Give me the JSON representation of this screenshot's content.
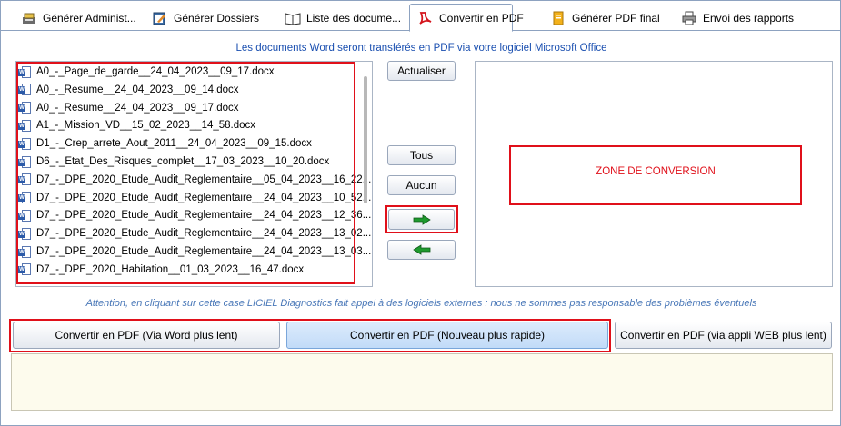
{
  "tabs": [
    {
      "label": "Générer Administ...",
      "icon": "admin-icon"
    },
    {
      "label": "Générer Dossiers",
      "icon": "folder-edit-icon"
    },
    {
      "label": "Liste des docume...",
      "icon": "book-icon"
    },
    {
      "label": "Convertir en PDF",
      "icon": "pdf-icon",
      "active": true
    },
    {
      "label": "Générer PDF final",
      "icon": "pdf-final-icon"
    },
    {
      "label": "Envoi des rapports",
      "icon": "printer-icon"
    }
  ],
  "info_top": "Les documents Word seront transférés en PDF via votre logiciel Microsoft Office",
  "files": [
    "A0_-_Page_de_garde__24_04_2023__09_17.docx",
    "A0_-_Resume__24_04_2023__09_14.docx",
    "A0_-_Resume__24_04_2023__09_17.docx",
    "A1_-_Mission_VD__15_02_2023__14_58.docx",
    "D1_-_Crep_arrete_Aout_2011__24_04_2023__09_15.docx",
    "D6_-_Etat_Des_Risques_complet__17_03_2023__10_20.docx",
    "D7_-_DPE_2020_Etude_Audit_Reglementaire__05_04_2023__16_22....",
    "D7_-_DPE_2020_Etude_Audit_Reglementaire__24_04_2023__10_52....",
    "D7_-_DPE_2020_Etude_Audit_Reglementaire__24_04_2023__12_36....",
    "D7_-_DPE_2020_Etude_Audit_Reglementaire__24_04_2023__13_02....",
    "D7_-_DPE_2020_Etude_Audit_Reglementaire__24_04_2023__13_03....",
    "D7_-_DPE_2020_Habitation__01_03_2023__16_47.docx"
  ],
  "buttons": {
    "refresh": "Actualiser",
    "all": "Tous",
    "none": "Aucun"
  },
  "zone_label": "ZONE DE CONVERSION",
  "warning": "Attention, en cliquant sur cette case LICIEL Diagnostics fait appel à des logiciels externes : nous ne sommes pas responsable des problèmes éventuels",
  "convert": {
    "word": "Convertir en PDF (Via Word plus lent)",
    "new": "Convertir en PDF (Nouveau plus rapide)",
    "web": "Convertir en PDF (via appli WEB plus lent)"
  },
  "colors": {
    "highlight": "#e0101a",
    "arrow_green": "#1f9a2e",
    "info_blue": "#1a4fb0"
  }
}
